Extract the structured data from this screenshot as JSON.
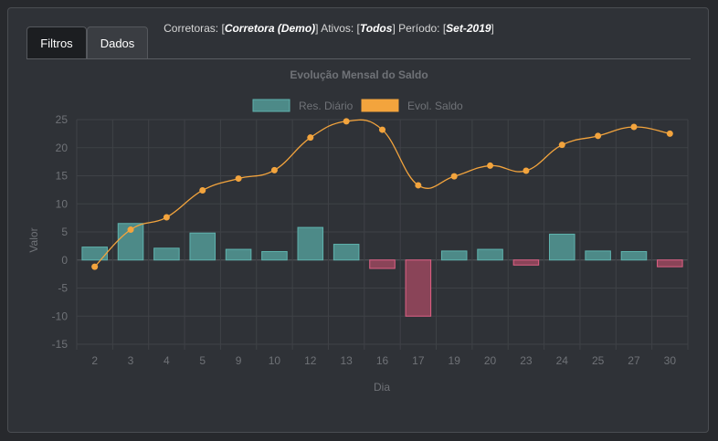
{
  "header": {
    "brokers_label": "Corretoras: ",
    "brokers_value": "Corretora (Demo)",
    "assets_label": " Ativos: ",
    "assets_value": "Todos",
    "period_label": " Período: ",
    "period_value": "Set-2019"
  },
  "tabs": [
    {
      "label": "Filtros",
      "active": true
    },
    {
      "label": "Dados",
      "active": false
    }
  ],
  "colors": {
    "bar_positive_fill": "#4d8a88",
    "bar_positive_stroke": "#5fb3ae",
    "bar_negative_fill": "#8a4458",
    "bar_negative_stroke": "#e06085",
    "line": "#f3a43d",
    "grid": "#3f4247",
    "text": "#6f7277"
  },
  "chart_data": {
    "type": "bar",
    "title": "Evolução Mensal do Saldo",
    "xlabel": "Dia",
    "ylabel": "Valor",
    "ylim": [
      -15,
      25
    ],
    "yticks": [
      25,
      20,
      15,
      10,
      5,
      0,
      -5,
      -10,
      -15
    ],
    "grid": true,
    "legend_position": "top",
    "categories": [
      "2",
      "3",
      "4",
      "5",
      "9",
      "10",
      "12",
      "13",
      "16",
      "17",
      "19",
      "20",
      "23",
      "24",
      "25",
      "27",
      "30"
    ],
    "series": [
      {
        "name": "Res. Diário",
        "type": "bar",
        "values": [
          2.3,
          6.5,
          2.1,
          4.8,
          1.9,
          1.5,
          5.8,
          2.8,
          -1.5,
          -10.0,
          1.6,
          1.9,
          -0.9,
          4.6,
          1.6,
          1.5,
          -1.2
        ]
      },
      {
        "name": "Evol. Saldo",
        "type": "line",
        "values": [
          -1.2,
          5.4,
          7.6,
          12.4,
          14.5,
          16.0,
          21.8,
          24.7,
          23.2,
          13.3,
          14.9,
          16.8,
          15.9,
          20.5,
          22.1,
          23.7,
          22.5
        ]
      }
    ]
  }
}
